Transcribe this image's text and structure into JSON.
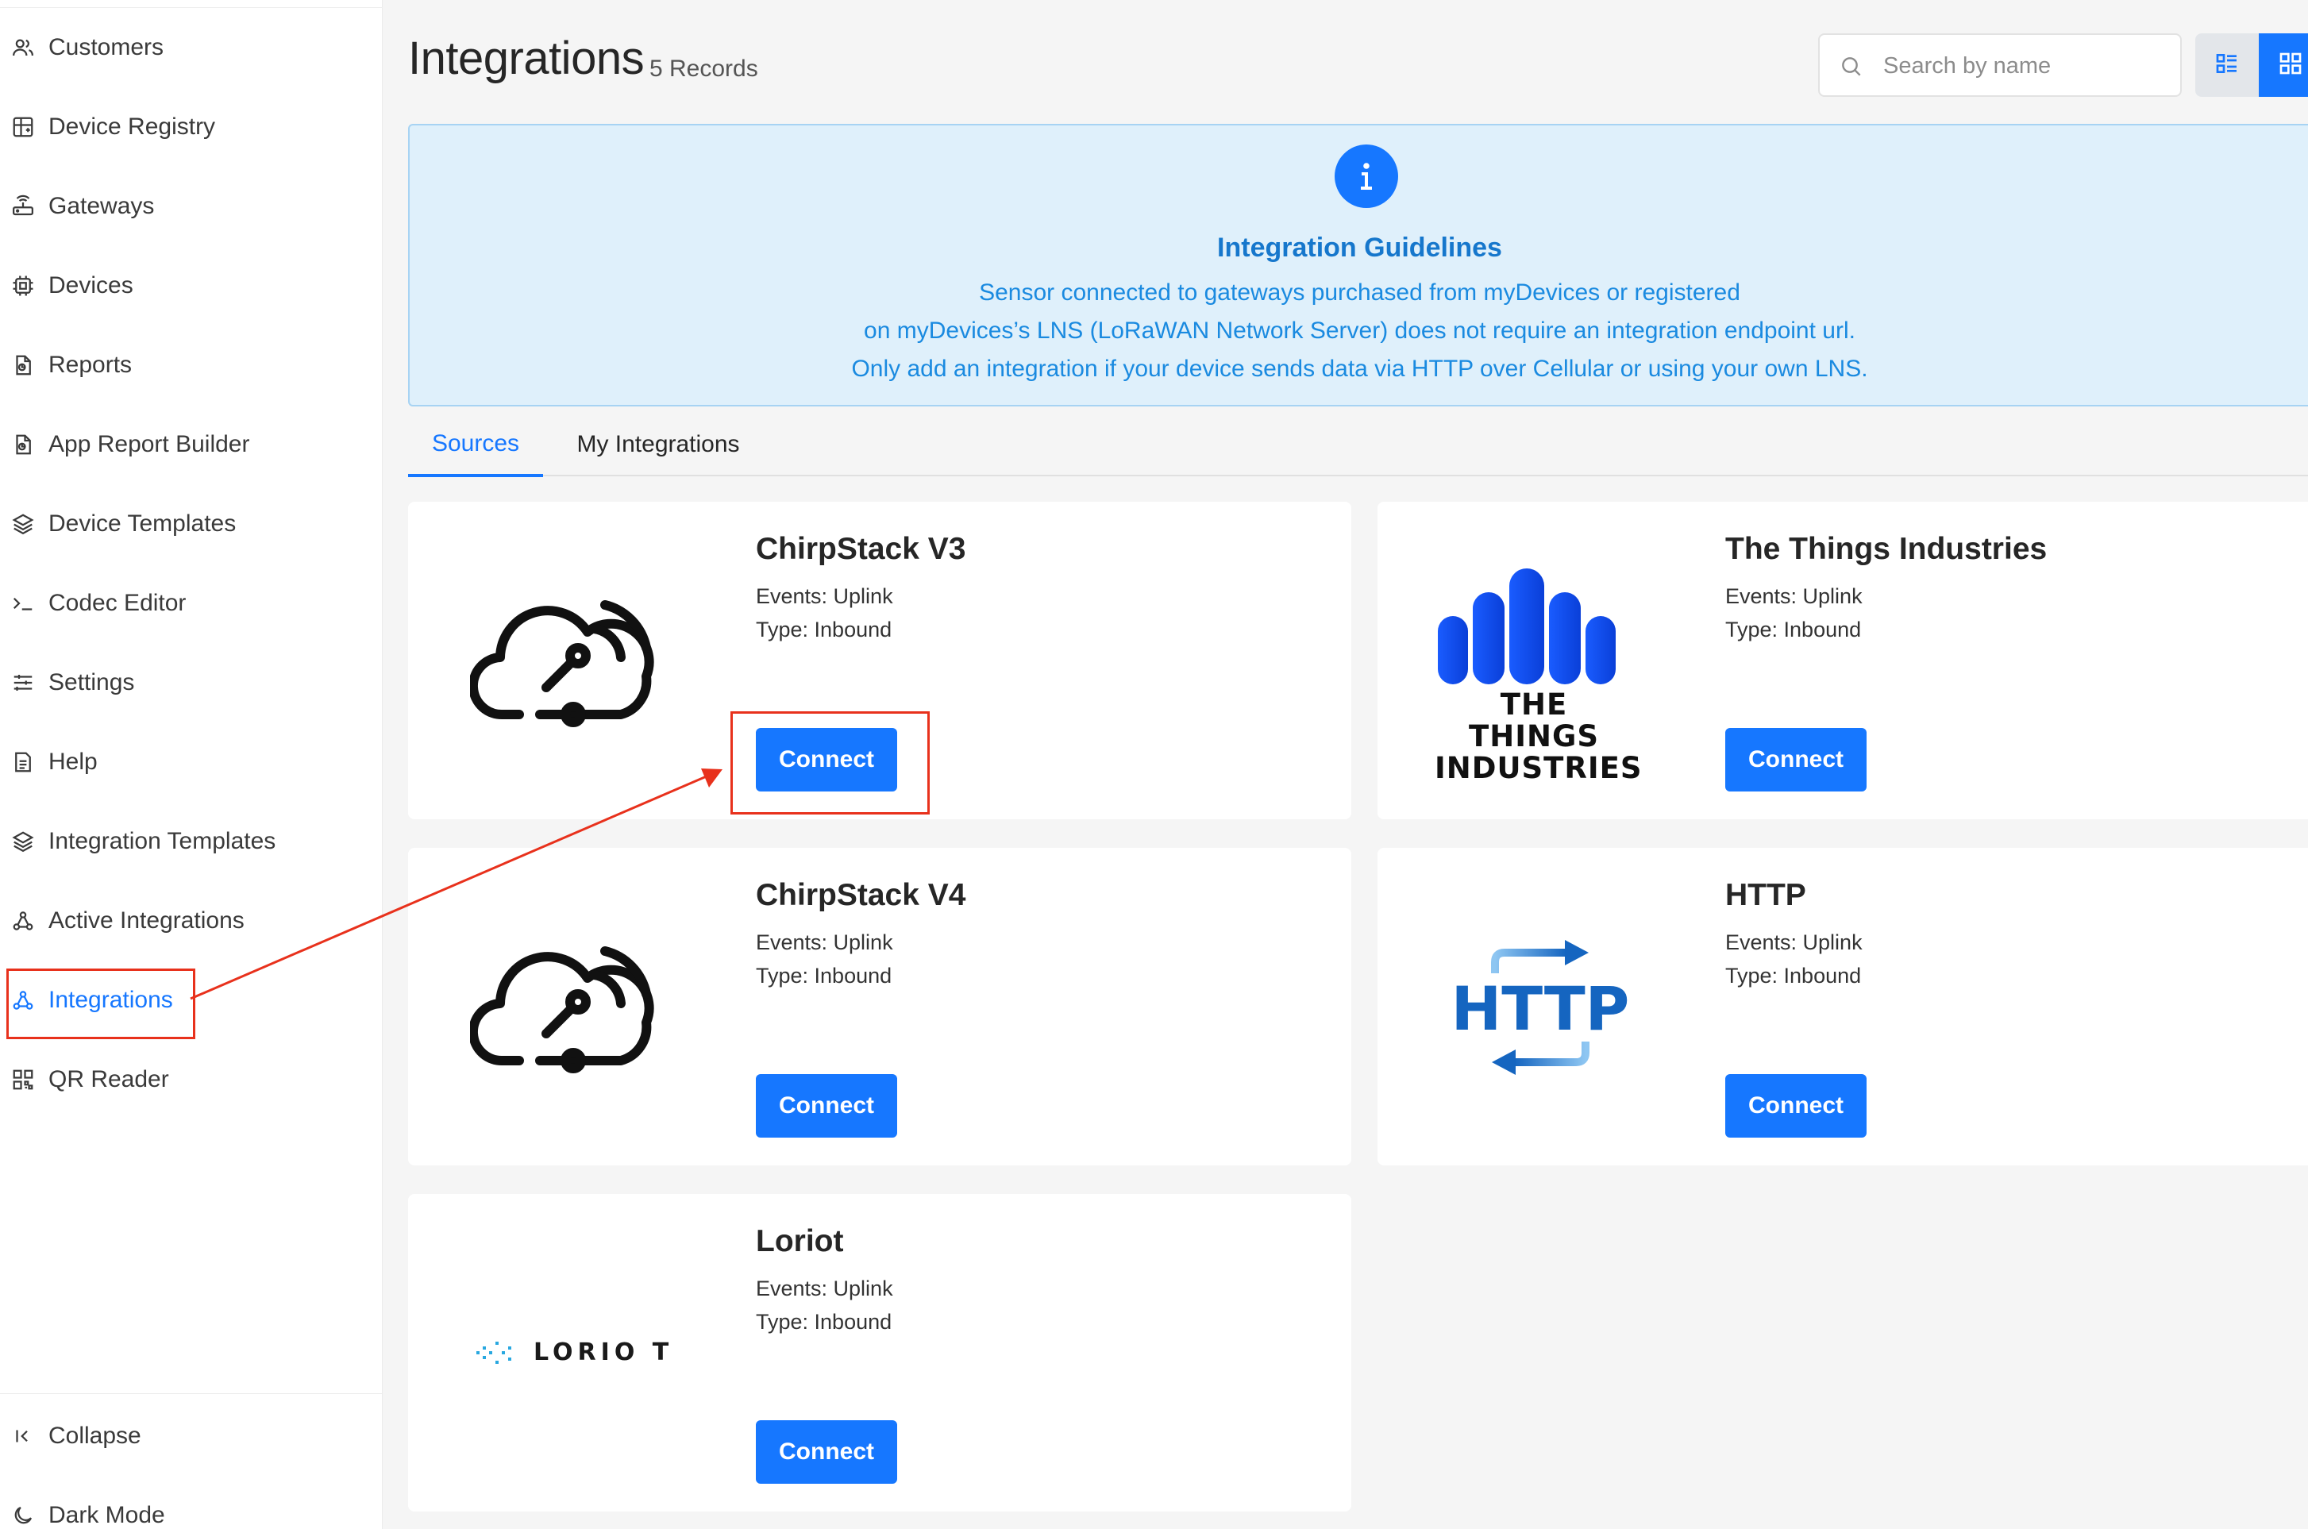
{
  "sidebar": {
    "items": [
      {
        "label": "Customers",
        "icon": "users-icon",
        "active": false
      },
      {
        "label": "Device Registry",
        "icon": "registry-icon",
        "active": false
      },
      {
        "label": "Gateways",
        "icon": "router-icon",
        "active": false
      },
      {
        "label": "Devices",
        "icon": "chip-icon",
        "active": false
      },
      {
        "label": "Reports",
        "icon": "report-icon",
        "active": false
      },
      {
        "label": "App Report Builder",
        "icon": "report-builder-icon",
        "active": false
      },
      {
        "label": "Device Templates",
        "icon": "layers-icon",
        "active": false
      },
      {
        "label": "Codec Editor",
        "icon": "terminal-icon",
        "active": false
      },
      {
        "label": "Settings",
        "icon": "sliders-icon",
        "active": false
      },
      {
        "label": "Help",
        "icon": "document-icon",
        "active": false
      },
      {
        "label": "Integration Templates",
        "icon": "layers-icon",
        "active": false
      },
      {
        "label": "Active Integrations",
        "icon": "webhook-icon",
        "active": false
      },
      {
        "label": "Integrations",
        "icon": "webhook-icon",
        "active": true
      },
      {
        "label": "QR Reader",
        "icon": "qr-icon",
        "active": false
      }
    ],
    "collapse_label": "Collapse",
    "dark_mode_label": "Dark Mode"
  },
  "header": {
    "title": "Integrations",
    "record_count": "5 Records",
    "search_placeholder": "Search by name"
  },
  "banner": {
    "title": "Integration Guidelines",
    "lines": [
      "Sensor connected to gateways purchased from myDevices or registered",
      "on myDevices’s LNS (LoRaWAN Network Server) does not require an integration endpoint url.",
      "Only add an integration if your device sends data via HTTP over Cellular or using your own LNS."
    ]
  },
  "tabs": {
    "sources": "Sources",
    "my_integrations": "My Integrations",
    "active": "sources"
  },
  "cards": [
    {
      "title": "ChirpStack V3",
      "events": "Events: Uplink",
      "type": "Type: Inbound",
      "button": "Connect",
      "logo": "chirpstack-logo"
    },
    {
      "title": "The Things Industries",
      "events": "Events: Uplink",
      "type": "Type: Inbound",
      "button": "Connect",
      "logo": "tti-logo",
      "logo_text_1": "THE THINGS",
      "logo_text_2": "INDUSTRIES"
    },
    {
      "title": "ChirpStack V4",
      "events": "Events: Uplink",
      "type": "Type: Inbound",
      "button": "Connect",
      "logo": "chirpstack-logo"
    },
    {
      "title": "HTTP",
      "events": "Events: Uplink",
      "type": "Type: Inbound",
      "button": "Connect",
      "logo": "http-logo",
      "logo_text": "HTTP"
    },
    {
      "title": "Loriot",
      "events": "Events: Uplink",
      "type": "Type: Inbound",
      "button": "Connect",
      "logo": "loriot-logo",
      "logo_text": "LORIO T"
    }
  ],
  "colors": {
    "accent": "#1677ff",
    "banner_bg": "#dff0fb",
    "annotation": "#e8311c"
  }
}
